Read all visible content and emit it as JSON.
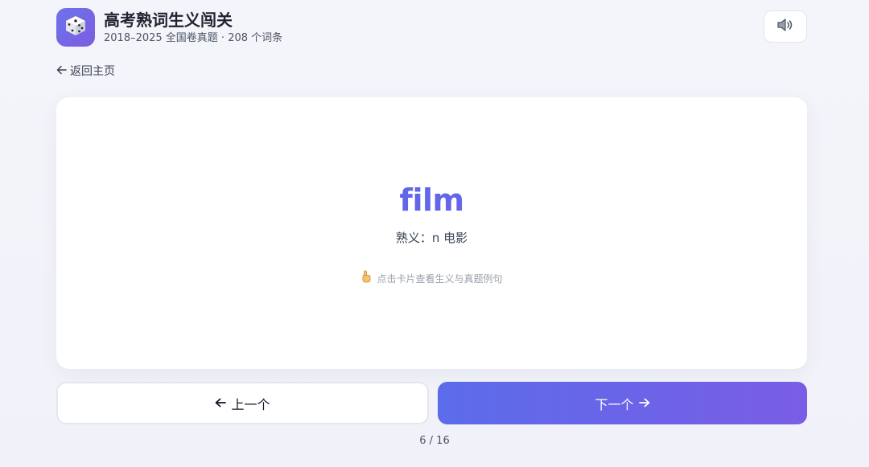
{
  "header": {
    "title": "高考熟词生义闯关",
    "subtitle": "2018–2025 全国卷真题 · 208 个词条",
    "logo_icon": "dice-icon",
    "sound_icon": "speaker-icon"
  },
  "nav": {
    "back_label": "返回主页"
  },
  "card": {
    "word": "film",
    "meaning": "熟义：n 电影",
    "hint": "点击卡片查看生义与真题例句",
    "hint_icon": "pointing-hand-icon"
  },
  "controls": {
    "prev_label": "上一个",
    "next_label": "下一个"
  },
  "progress": {
    "text": "6 / 16",
    "current": 6,
    "total": 16
  },
  "colors": {
    "accent": "#6366e8",
    "button_gradient_start": "#5b6cea",
    "button_gradient_end": "#7a5de6"
  }
}
